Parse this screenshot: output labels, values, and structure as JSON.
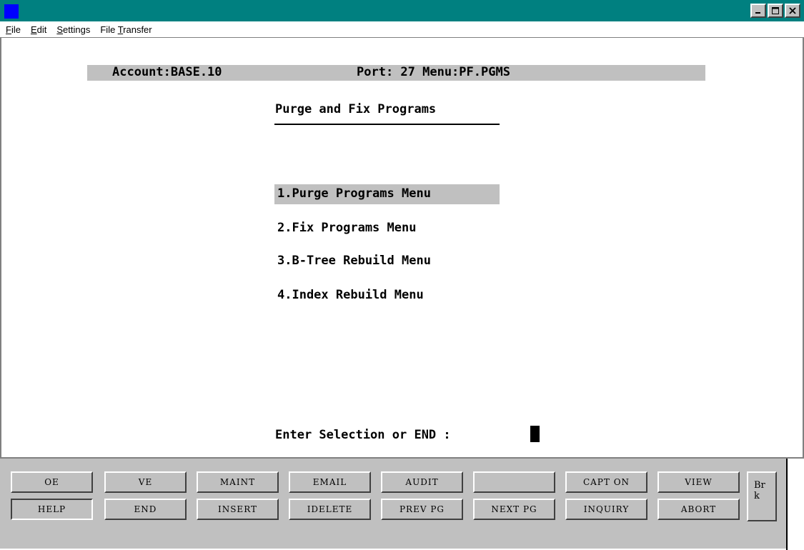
{
  "window": {
    "icon": "terminal-app-icon",
    "buttons": [
      "minimize-icon",
      "maximize-icon",
      "close-icon"
    ],
    "accent": "#008080"
  },
  "menubar": {
    "items": [
      {
        "label_pre": "",
        "mnemonic": "F",
        "label_post": "ile"
      },
      {
        "label_pre": "",
        "mnemonic": "E",
        "label_post": "dit"
      },
      {
        "label_pre": "",
        "mnemonic": "S",
        "label_post": "ettings"
      },
      {
        "label_pre": "File ",
        "mnemonic": "T",
        "label_post": "ransfer"
      }
    ]
  },
  "terminal": {
    "account": "Account:BASE.10",
    "port_menu": "Port: 27 Menu:PF.PGMS",
    "title": "Purge and Fix Programs",
    "options": [
      "1.Purge Programs Menu",
      "2.Fix Programs Menu",
      "3.B-Tree Rebuild Menu",
      "4.Index Rebuild Menu"
    ],
    "prompt": "Enter Selection or END :"
  },
  "function_keys": {
    "row1": [
      "OE",
      "VE",
      "MAINT",
      "EMAIL",
      "AUDIT",
      "",
      "CAPT ON",
      "VIEW"
    ],
    "row2": [
      "HELP",
      "END",
      "INSERT",
      "IDELETE",
      "PREV PG",
      "NEXT PG",
      "INQUIRY",
      "ABORT"
    ],
    "brk_line1": "Br",
    "brk_line2": "k"
  }
}
